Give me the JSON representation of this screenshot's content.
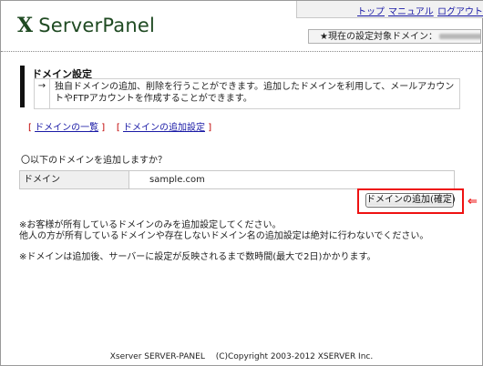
{
  "app": {
    "logo_mark": "X",
    "logo_text": "ServerPanel"
  },
  "topnav": {
    "top": "トップ",
    "manual": "マニュアル",
    "logout": "ログアウト"
  },
  "current_domain_label": "★現在の設定対象ドメイン：",
  "section": {
    "title": "ドメイン設定",
    "arrow": "→",
    "description": "独自ドメインの追加、削除を行うことができます。追加したドメインを利用して、メールアカウントやFTPアカウントを作成することができます。"
  },
  "links": {
    "open1": "[",
    "domain_list": "ドメインの一覧",
    "close1": "]",
    "open2": "[",
    "add_domain": "ドメインの追加設定",
    "close2": "]"
  },
  "question": "〇以下のドメインを追加しますか？",
  "form": {
    "label": "ドメイン",
    "value": "sample.com"
  },
  "confirm_button": "ドメインの追加(確定)",
  "annotation_arrow": "⇐",
  "notes": [
    "※お客様が所有しているドメインのみを追加設定してください。",
    "他人の方が所有しているドメインや存在しないドメイン名の追加設定は絶対に行わないでください。",
    "※ドメインは追加後、サーバーに設定が反映されるまで数時間(最大で2日)かかります。"
  ],
  "footer": "Xserver SERVER-PANEL　 (C)Copyright 2003-2012 XSERVER Inc.",
  "colors": {
    "logo": "#1f4a22",
    "link": "#1a1aa6",
    "bracket": "#c00000",
    "highlight": "#e11111"
  }
}
